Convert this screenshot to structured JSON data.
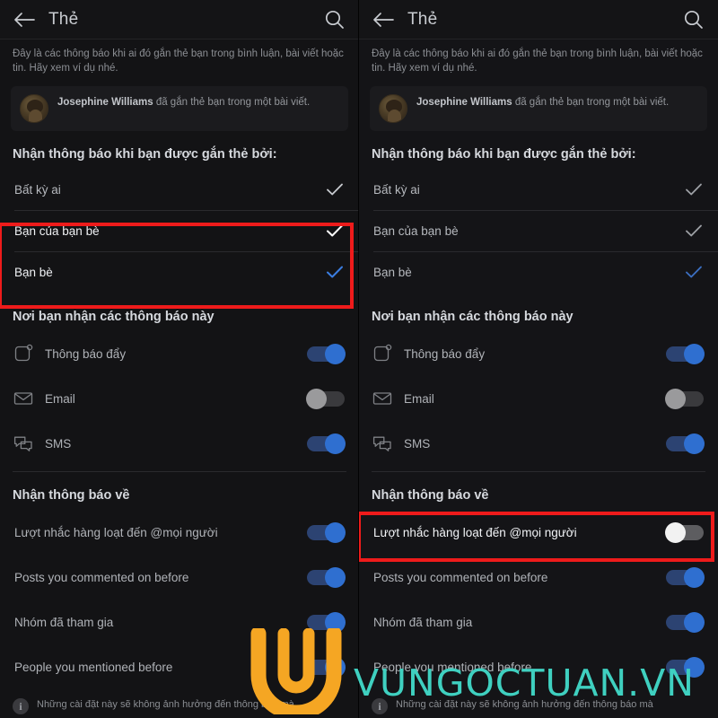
{
  "header": {
    "title": "Thẻ",
    "back_icon": "arrow-left-icon",
    "search_icon": "search-icon"
  },
  "description": "Đây là các thông báo khi ai đó gắn thẻ bạn trong bình luận, bài viết hoặc tin. Hãy xem ví dụ nhé.",
  "example": {
    "name": "Josephine Williams",
    "rest": " đã gắn thẻ bạn trong một bài viết."
  },
  "sections": {
    "tagged_by_title": "Nhận thông báo khi bạn được gắn thẻ bởi:",
    "delivery_title": "Nơi bạn nhận các thông báo này",
    "about_title": "Nhận thông báo về"
  },
  "audience_rows": [
    {
      "label": "Bất kỳ ai",
      "checked": true,
      "check_color": "#c7cacf",
      "highlight": false
    },
    {
      "label": "Bạn của bạn bè",
      "checked": true,
      "check_color": "#ffffff",
      "highlight": true
    },
    {
      "label": "Bạn bè",
      "checked": true,
      "check_color": "#3b7de0",
      "highlight": true
    }
  ],
  "delivery_rows": [
    {
      "label": "Thông báo đẩy",
      "icon": "push-notification-icon",
      "state": "on"
    },
    {
      "label": "Email",
      "icon": "envelope-icon",
      "state": "off"
    },
    {
      "label": "SMS",
      "icon": "speech-bubbles-icon",
      "state": "on"
    }
  ],
  "about_rows_left": [
    {
      "label": "Lượt nhắc hàng loạt đến @mọi người",
      "state": "on"
    },
    {
      "label": "Posts you commented on before",
      "state": "on"
    },
    {
      "label": "Nhóm đã tham gia",
      "state": "on"
    },
    {
      "label": "People you mentioned before",
      "state": "on"
    }
  ],
  "about_rows_right": [
    {
      "label": "Lượt nhắc hàng loạt đến @mọi người",
      "state": "off"
    },
    {
      "label": "Posts you commented on before",
      "state": "on"
    },
    {
      "label": "Nhóm đã tham gia",
      "state": "on"
    },
    {
      "label": "People you mentioned before",
      "state": "on"
    }
  ],
  "footnote": "Những cài đặt này sẽ không ảnh hưởng đến thông báo mà",
  "footnote_icon": "info-icon",
  "watermark": {
    "text": "VUNGOCTUAN.VN",
    "logo_name": "vungoctuan-u-logo",
    "logo_color": "#F5A623",
    "text_color": "#3FD0C0"
  },
  "annotation": {
    "color": "#EE1B1B",
    "left_box_label": "audience-rows-highlight",
    "right_box_label": "mass-mentions-row-highlight"
  }
}
